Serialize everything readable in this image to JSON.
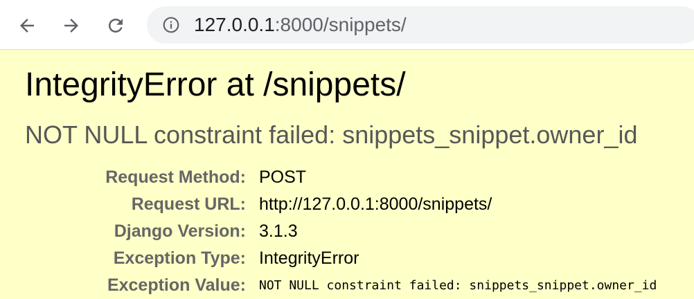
{
  "browser": {
    "back_icon": "arrow-left-icon",
    "forward_icon": "arrow-right-icon",
    "reload_icon": "reload-icon",
    "site_info_icon": "info-icon",
    "url_host": "127.0.0.1",
    "url_rest": ":8000/snippets/"
  },
  "error": {
    "title": "IntegrityError at /snippets/",
    "value": "NOT NULL constraint failed: snippets_snippet.owner_id"
  },
  "meta": {
    "rows": [
      {
        "label": "Request Method:",
        "value": "POST"
      },
      {
        "label": "Request URL:",
        "value": "http://127.0.0.1:8000/snippets/"
      },
      {
        "label": "Django Version:",
        "value": "3.1.3"
      },
      {
        "label": "Exception Type:",
        "value": "IntegrityError"
      },
      {
        "label": "Exception Value:",
        "value": "NOT NULL constraint failed: snippets_snippet.owner_id"
      }
    ]
  },
  "colors": {
    "page_bg": "#ffffc8",
    "label_gray": "#666666",
    "subtitle_gray": "#575757"
  }
}
